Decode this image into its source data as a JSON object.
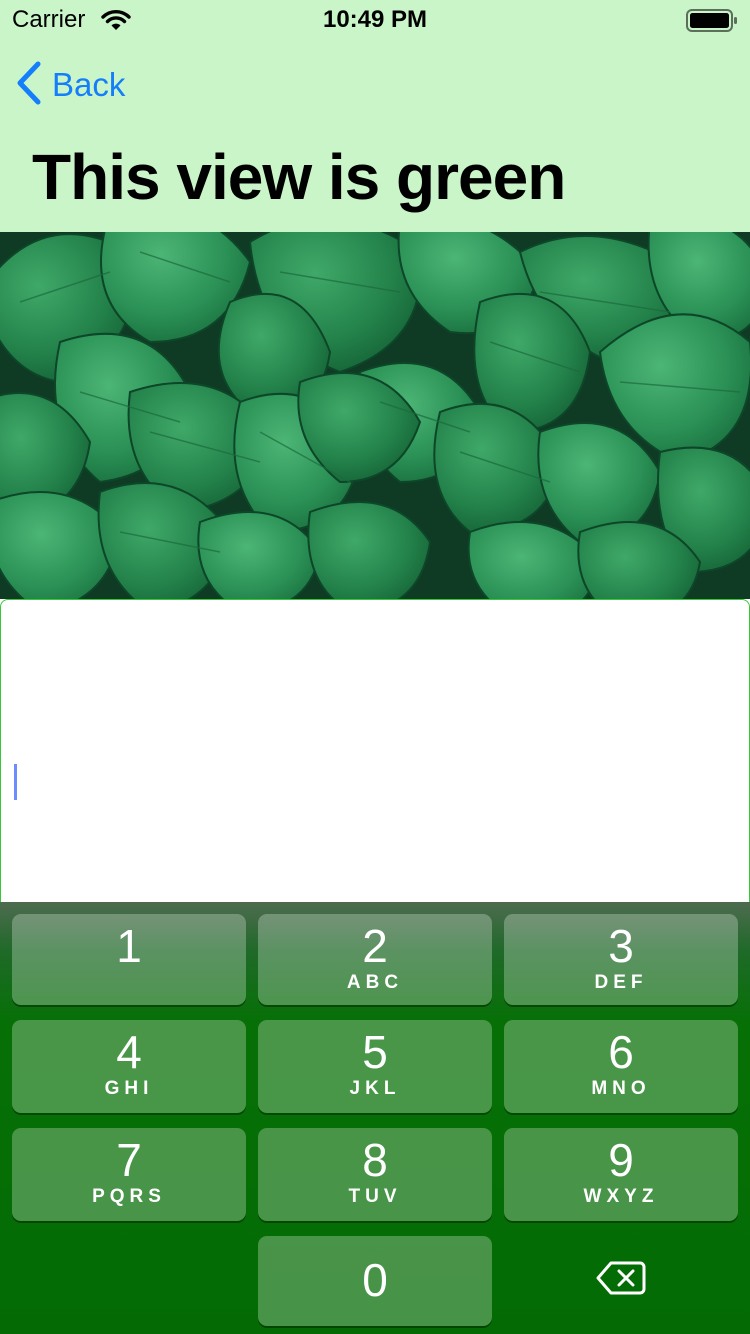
{
  "status_bar": {
    "carrier": "Carrier",
    "time": "10:49 PM",
    "wifi_icon": "wifi-icon",
    "battery_icon": "battery-icon"
  },
  "nav": {
    "back_label": "Back",
    "back_icon": "chevron-left-icon",
    "title": "This view is green"
  },
  "image": {
    "subject": "green-leaves-photo"
  },
  "text_input": {
    "value": ""
  },
  "keypad": {
    "keys": [
      {
        "digit": "1",
        "letters": ""
      },
      {
        "digit": "2",
        "letters": "ABC"
      },
      {
        "digit": "3",
        "letters": "DEF"
      },
      {
        "digit": "4",
        "letters": "GHI"
      },
      {
        "digit": "5",
        "letters": "JKL"
      },
      {
        "digit": "6",
        "letters": "MNO"
      },
      {
        "digit": "7",
        "letters": "PQRS"
      },
      {
        "digit": "8",
        "letters": "TUV"
      },
      {
        "digit": "9",
        "letters": "WXYZ"
      },
      {
        "digit": "0",
        "letters": ""
      }
    ],
    "delete_icon": "backspace-icon"
  },
  "colors": {
    "nav_background": "#c9f5c8",
    "accent": "#147efb",
    "keypad_background": "#046b04",
    "caret": "#6f8cff"
  }
}
